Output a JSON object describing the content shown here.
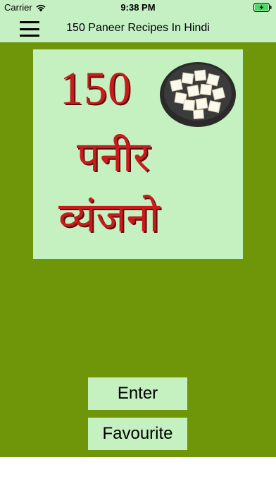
{
  "status_bar": {
    "carrier": "Carrier",
    "time": "9:38 PM",
    "icons": [
      "wifi-icon",
      "battery-charging-icon"
    ]
  },
  "nav": {
    "title": "150 Paneer Recipes In Hindi",
    "menu_icon": "hamburger-menu-icon"
  },
  "cover": {
    "number": "150",
    "line1": "पनीर",
    "line2": "व्यंजनो",
    "image": "paneer-bowl-icon"
  },
  "buttons": {
    "enter": "Enter",
    "favourite": "Favourite"
  },
  "colors": {
    "bar_background": "#c4f0c4",
    "main_background": "#6e9608",
    "cover_background": "#c5f0c0",
    "title_red": "#c81c1c",
    "battery_green": "#4cd964"
  }
}
